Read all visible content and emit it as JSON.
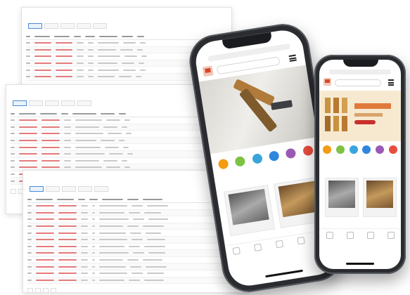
{
  "colors": {
    "accent_red": "#e57b7b",
    "brand_red": "#d9472b",
    "tab_active_blue": "#4a8bd6",
    "category_icons": [
      "#f39c12",
      "#7dc242",
      "#3aa5dc",
      "#2e86de",
      "#9b59b6",
      "#e74c3c"
    ]
  },
  "sheets": [
    {
      "title": "",
      "tabs": [
        "",
        "",
        "",
        "",
        ""
      ]
    },
    {
      "title": "",
      "tabs": [
        "",
        "",
        "",
        "",
        ""
      ]
    },
    {
      "title": "",
      "tabs": [
        "",
        "",
        "",
        "",
        ""
      ]
    }
  ],
  "phone_large": {
    "url": "",
    "section_heading": ""
  },
  "phone_small": {
    "url": "",
    "section_heading": ""
  },
  "icons": {
    "brand": "brand-logo-icon",
    "menu": "hamburger-menu-icon",
    "search": "search-icon"
  }
}
